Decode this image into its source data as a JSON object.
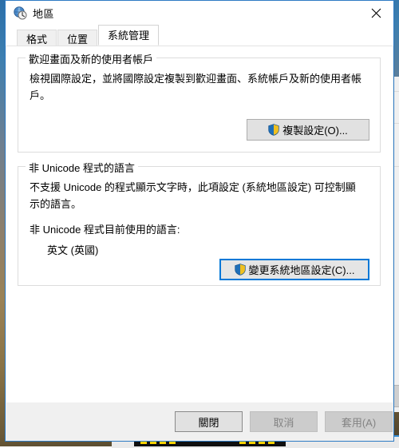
{
  "window": {
    "title": "地區",
    "icon": "region-globe-clock-icon",
    "close_label": "✕",
    "accent_color": "#0078d7",
    "border_color": "#2e7bc4"
  },
  "tabs": [
    {
      "label": "格式",
      "active": false
    },
    {
      "label": "位置",
      "active": false
    },
    {
      "label": "系統管理",
      "active": true
    }
  ],
  "groups": [
    {
      "legend": "歡迎畫面及新的使用者帳戶",
      "description": "檢視國際設定，並將國際設定複製到歡迎畫面、系統帳戶及新的使用者帳戶。",
      "button": {
        "label": "複製設定(O)...",
        "icon": "uac-shield-icon",
        "focused": false
      }
    },
    {
      "legend": "非 Unicode 程式的語言",
      "description": "不支援 Unicode 的程式顯示文字時，此項設定 (系統地區設定) 可控制顯示的語言。",
      "current_label": "非 Unicode 程式目前使用的語言:",
      "current_value": "英文 (英國)",
      "button": {
        "label": "變更系統地區設定(C)...",
        "icon": "uac-shield-icon",
        "focused": true
      }
    }
  ],
  "footer": {
    "buttons": [
      {
        "label": "關閉",
        "state": "default"
      },
      {
        "label": "取消",
        "state": "disabled"
      },
      {
        "label": "套用(A)",
        "state": "disabled"
      }
    ]
  }
}
